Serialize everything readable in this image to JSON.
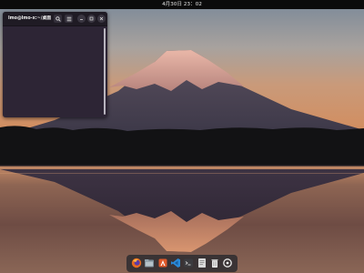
{
  "top_bar": {
    "clock": "4月30日 23：02"
  },
  "terminal": {
    "title": "lmo@lmo-x:~/桌面",
    "buttons": [
      "search-icon",
      "hamburger-menu-icon",
      "minimize-icon",
      "maximize-icon",
      "close-icon"
    ]
  },
  "dock": {
    "apps": [
      "firefox-icon",
      "files-icon",
      "app-store-icon",
      "vscode-icon",
      "terminal-icon",
      "text-editor-icon",
      "trash-icon",
      "app-grid-icon"
    ]
  },
  "colors": {
    "top_bar": "#0b0b0b",
    "terminal_background": "#2d2535",
    "terminal_header": "#1f1b24",
    "sky_top": "#8b97a6",
    "sky_horizon": "#d09064",
    "lake": "#7d5a4a"
  }
}
